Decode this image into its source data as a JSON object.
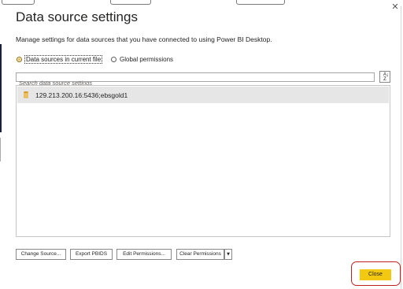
{
  "dialog": {
    "title": "Data source settings",
    "subtitle": "Manage settings for data sources that you have connected to using Power BI Desktop."
  },
  "scope": {
    "options": [
      {
        "label": "Data sources in current file",
        "selected": true
      },
      {
        "label": "Global permissions",
        "selected": false
      }
    ]
  },
  "search": {
    "placeholder": "Search data source settings",
    "value": ""
  },
  "sort_button": {
    "label": "A Z",
    "icon": "sort-az-icon"
  },
  "data_sources": [
    {
      "name": "129.213.200.16:5436;ebsgold1",
      "icon": "database-icon",
      "selected": true
    }
  ],
  "actions": {
    "change_source": "Change Source...",
    "export_pbids": "Export PBIDS",
    "edit_permissions": "Edit Permissions...",
    "clear_permissions": "Clear Permissions",
    "clear_permissions_dropdown_icon": "chevron-down-icon"
  },
  "footer": {
    "close_label": "Close"
  },
  "colors": {
    "accent_yellow": "#F2C811",
    "highlight_red": "#C0221F",
    "selected_row": "#E6E6E6",
    "db_icon": "#E8B54D"
  }
}
